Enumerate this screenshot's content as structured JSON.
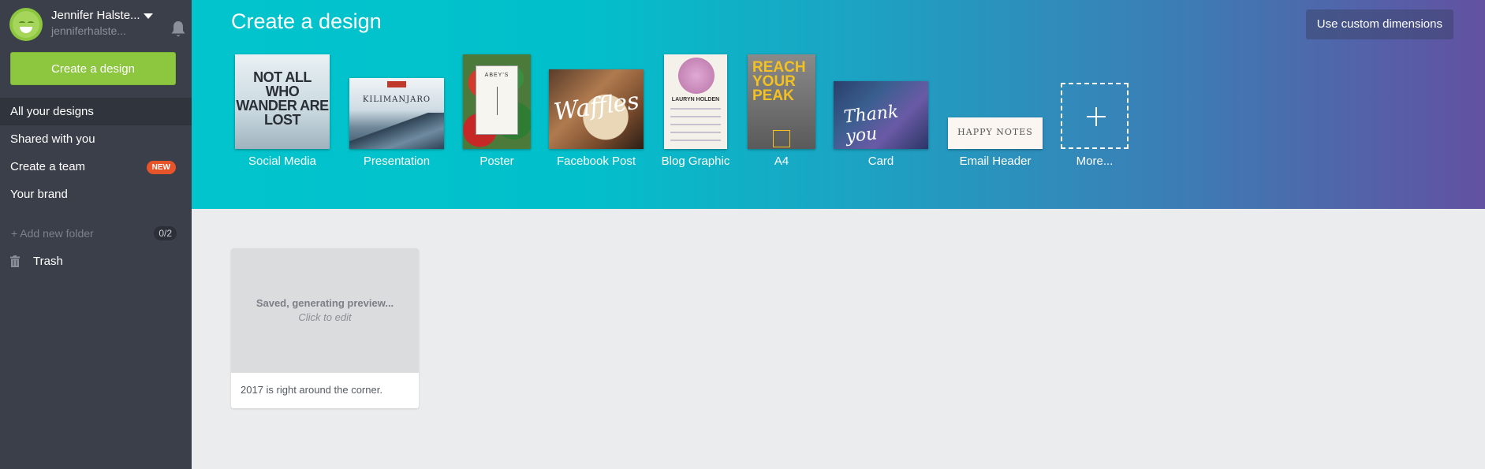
{
  "user": {
    "name": "Jennifer Halste...",
    "email": "jenniferhalste..."
  },
  "sidebar": {
    "create_button": "Create a design",
    "nav": [
      {
        "label": "All your designs",
        "active": true
      },
      {
        "label": "Shared with you"
      },
      {
        "label": "Create a team",
        "badge": "NEW"
      },
      {
        "label": "Your brand"
      }
    ],
    "add_folder": "+ Add new folder",
    "folder_count": "0/2",
    "trash": "Trash"
  },
  "header": {
    "title": "Create a design",
    "custom_dimensions": "Use custom dimensions",
    "design_types": [
      {
        "label": "Social Media",
        "thumb_text": "NOT ALL WHO WANDER ARE LOST"
      },
      {
        "label": "Presentation",
        "thumb_text": "KILIMANJARO"
      },
      {
        "label": "Poster",
        "thumb_text": "ABEY'S"
      },
      {
        "label": "Facebook Post",
        "thumb_text": "Waffles"
      },
      {
        "label": "Blog Graphic",
        "thumb_text": "LAURYN HOLDEN"
      },
      {
        "label": "A4",
        "thumb_text": "REACH YOUR PEAK"
      },
      {
        "label": "Card",
        "thumb_text": "Thank you"
      },
      {
        "label": "Email Header",
        "thumb_text": "HAPPY NOTES"
      },
      {
        "label": "More..."
      }
    ]
  },
  "designs": [
    {
      "preview_title": "Saved, generating preview...",
      "preview_sub": "Click to edit",
      "caption": "2017 is right around the corner."
    }
  ],
  "colors": {
    "accent_green": "#8dc63f",
    "sidebar_bg": "#3b3f4a",
    "header_start": "#01c4cc",
    "header_end": "#6251a1",
    "badge_new": "#e8542a"
  }
}
